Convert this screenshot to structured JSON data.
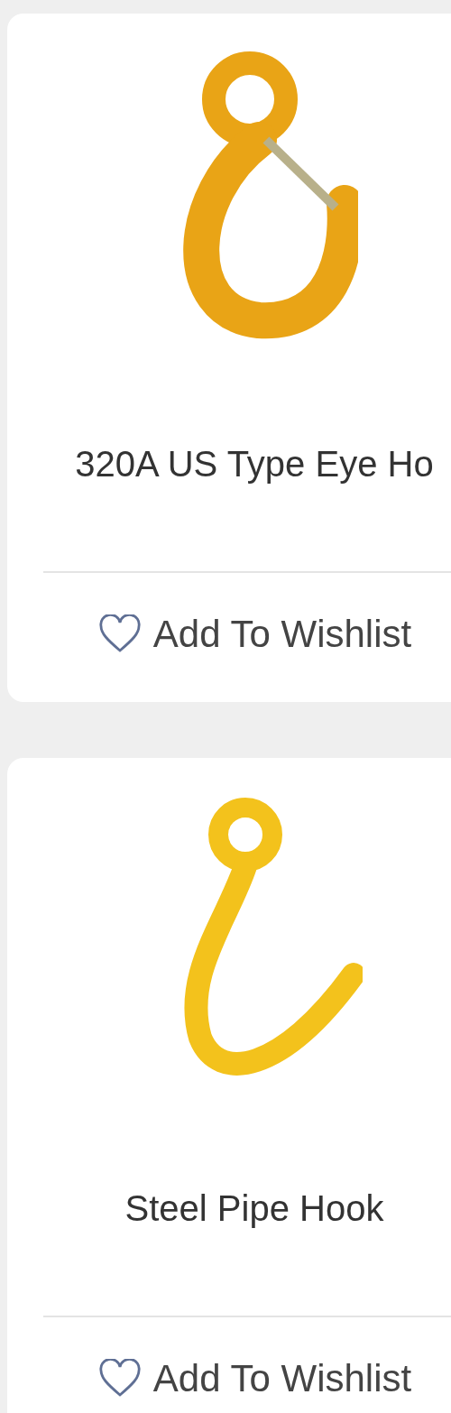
{
  "products": [
    {
      "title": "320A US Type Eye Ho",
      "wishlist_label": "Add To Wishlist",
      "kind": "eye"
    },
    {
      "title": "Steel Pipe Hook",
      "wishlist_label": "Add To Wishlist",
      "kind": "pipe"
    }
  ]
}
